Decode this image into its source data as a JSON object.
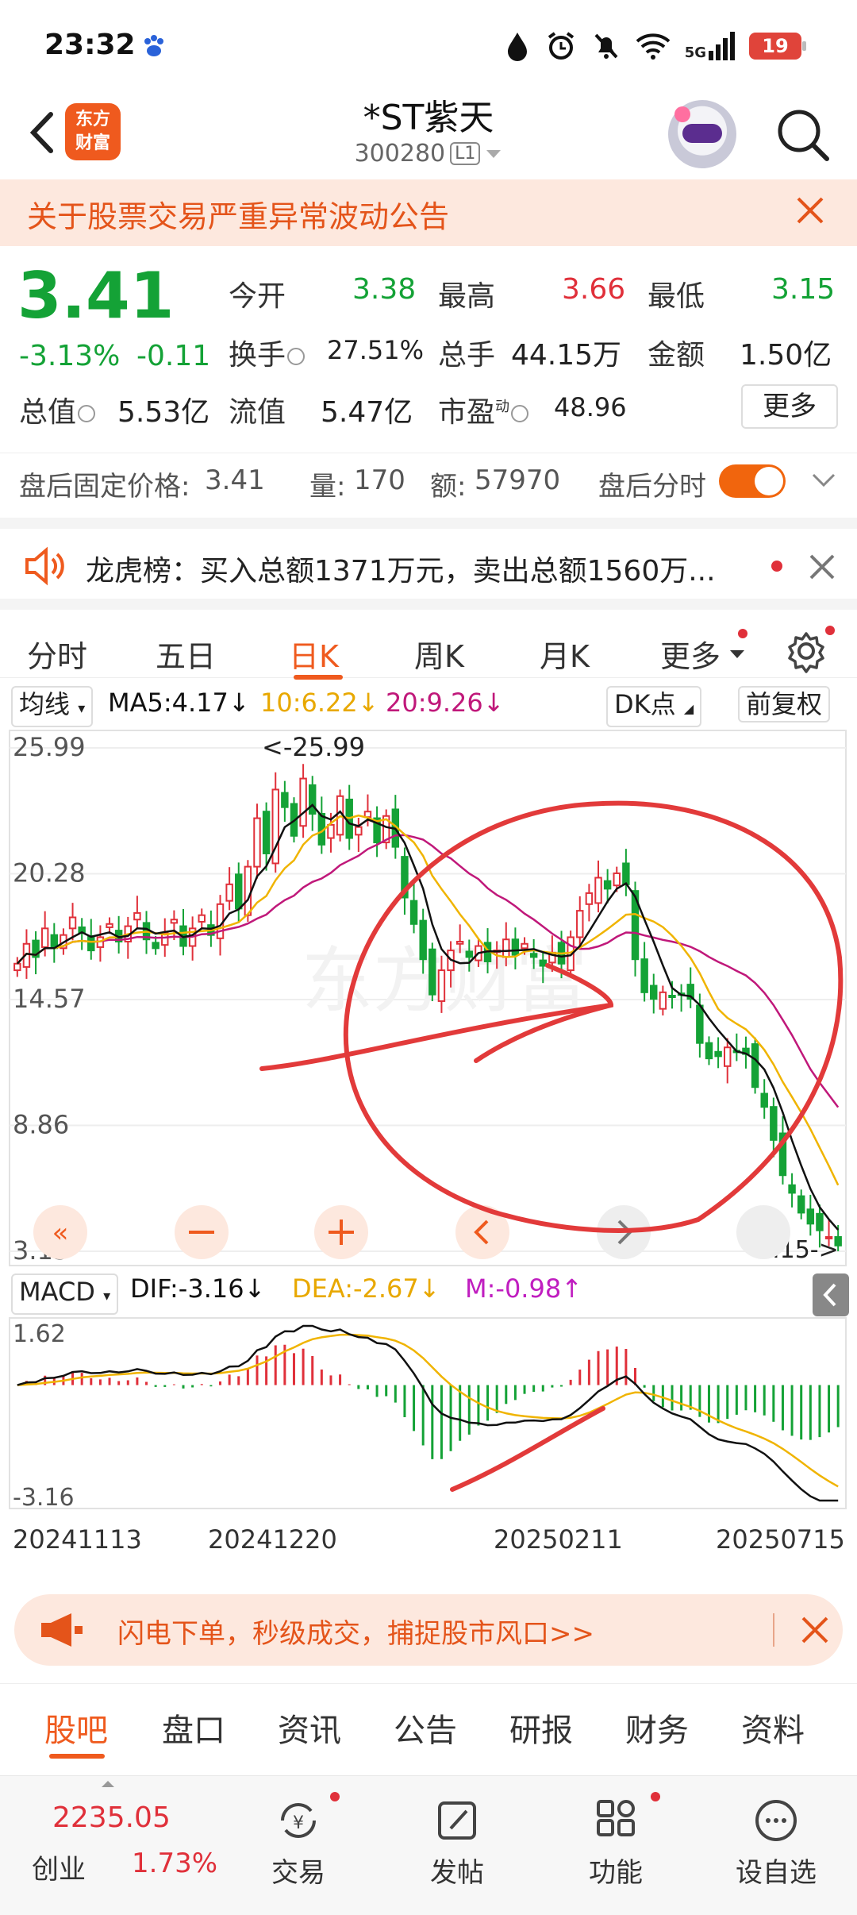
{
  "status": {
    "time": "23:32",
    "network": "5G",
    "battery": "19"
  },
  "header": {
    "logo_line1": "东方",
    "logo_line2": "财富",
    "stock_name": "*ST紫天",
    "stock_code": "300280",
    "level": "L1"
  },
  "notice": {
    "text": "关于股票交易严重异常波动公告"
  },
  "quote": {
    "price": "3.41",
    "change_pct": "-3.13%",
    "change_val": "-0.11",
    "open_label": "今开",
    "open": "3.38",
    "high_label": "最高",
    "high": "3.66",
    "low_label": "最低",
    "low": "3.15",
    "turnover_label": "换手",
    "turnover": "27.51%",
    "volume_label": "总手",
    "volume": "44.15万",
    "amount_label": "金额",
    "amount": "1.50亿",
    "mktcap_label": "总值",
    "mktcap": "5.53亿",
    "float_label": "流值",
    "float": "5.47亿",
    "pe_label": "市盈",
    "pe_sup": "动",
    "pe": "48.96",
    "more": "更多"
  },
  "afterhours": {
    "fixed_label": "盘后固定价格:",
    "fixed_price": "3.41",
    "vol_label": "量:",
    "vol": "170",
    "amt_label": "额:",
    "amt": "57970",
    "timeshare_label": "盘后分时"
  },
  "longhu": {
    "text": "龙虎榜：买入总额1371万元，卖出总额1560万..."
  },
  "tabs": [
    "分时",
    "五日",
    "日K",
    "周K",
    "月K",
    "更多"
  ],
  "ma": {
    "selector": "均线",
    "ma5": "MA5:4.17↓",
    "ma10": "10:6.22↓",
    "ma20": "20:9.26↓",
    "dk": "DK点",
    "adjust": "前复权"
  },
  "colors": {
    "up": "#e0303a",
    "down": "#14a236",
    "ma5": "#111111",
    "ma10": "#f0b400",
    "ma20": "#c0187a",
    "accent": "#ef5a1e"
  },
  "chart_data": [
    {
      "type": "candlestick",
      "y_ticks": [
        "25.99",
        "20.28",
        "14.57",
        "8.86",
        "3.15"
      ],
      "ylim": [
        3.15,
        25.99
      ],
      "max_annotation": "<-25.99",
      "min_annotation": "3.15->",
      "watermark": "东方财富",
      "x_ticks": [
        "20241113",
        "20241220",
        "20250211",
        "20250715"
      ],
      "series": [
        {
          "name": "MA5",
          "value": "4.17"
        },
        {
          "name": "10",
          "value": "6.22"
        },
        {
          "name": "20",
          "value": "9.26"
        }
      ],
      "close": [
        16.2,
        17.1,
        16.5,
        17.8,
        16.9,
        17.5,
        18.3,
        17.6,
        16.8,
        17.4,
        18.0,
        17.2,
        17.9,
        18.5,
        17.3,
        16.9,
        17.6,
        18.2,
        17.0,
        17.8,
        18.4,
        17.5,
        18.9,
        19.8,
        18.7,
        20.6,
        22.8,
        21.2,
        24.1,
        23.3,
        22.0,
        24.6,
        23.0,
        21.6,
        22.5,
        23.8,
        21.9,
        22.4,
        23.1,
        21.7,
        22.9,
        21.5,
        19.2,
        18.0,
        16.4,
        14.8,
        15.9,
        16.8,
        17.2,
        16.5,
        17.0,
        16.3,
        16.8,
        17.3,
        16.6,
        17.1,
        16.5,
        16.1,
        16.7,
        16.2,
        17.4,
        18.6,
        19.4,
        20.1,
        19.6,
        20.3,
        19.8,
        16.4,
        14.9,
        14.6,
        14.9,
        14.7,
        14.8,
        14.6,
        12.6,
        11.9,
        12.0,
        12.4,
        12.2,
        12.1,
        10.6,
        9.7,
        8.2,
        6.6,
        5.8,
        4.9,
        4.4,
        4.1,
        3.8,
        3.41
      ],
      "macd": {
        "ylim": [
          -3.16,
          1.62
        ],
        "dif": "-3.16",
        "dea": "-2.67",
        "m": "-0.98"
      }
    }
  ],
  "macd_label": "MACD",
  "promo": {
    "text": "闪电下单，秒级成交，捕捉股市风口>>"
  },
  "subtabs": [
    "股吧",
    "盘口",
    "资讯",
    "公告",
    "研报",
    "财务",
    "资料"
  ],
  "bottom": {
    "index_value": "2235.05",
    "index_name": "创业",
    "index_pct": "1.73%",
    "nav": [
      "交易",
      "发帖",
      "功能",
      "设自选"
    ]
  }
}
